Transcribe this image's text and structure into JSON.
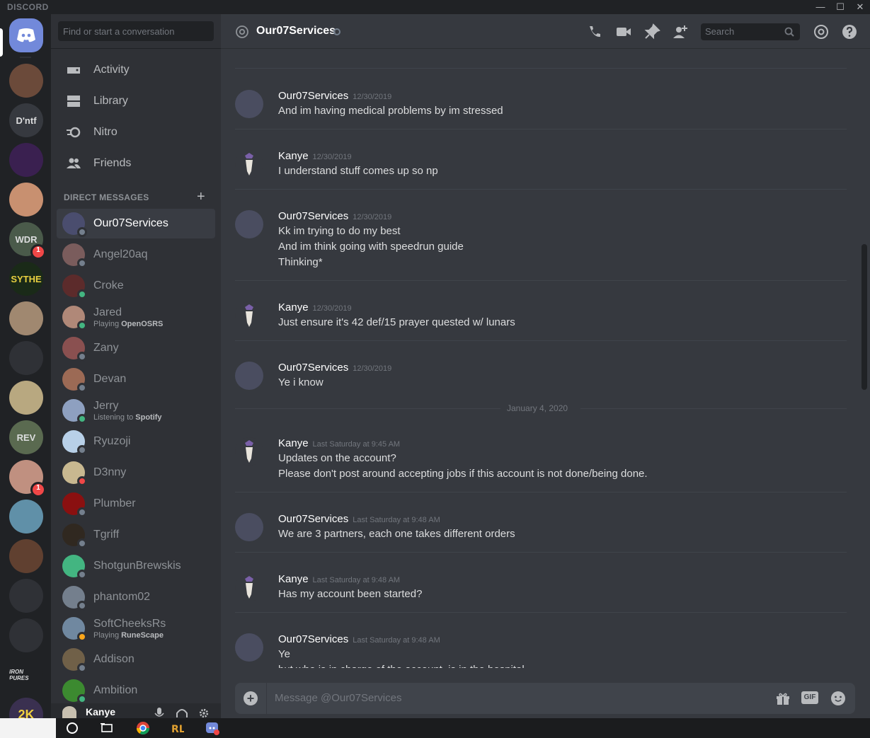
{
  "app": {
    "brand": "DISCORD"
  },
  "window_controls": {
    "minimize": "—",
    "maximize": "☐",
    "close": "✕"
  },
  "guilds": [
    {
      "name": "home",
      "text": ""
    },
    {
      "name": "server-1",
      "text": ""
    },
    {
      "name": "server-dntf",
      "text": "D'ntf"
    },
    {
      "name": "server-3",
      "text": ""
    },
    {
      "name": "server-4",
      "text": ""
    },
    {
      "name": "server-wdr",
      "text": "WDR",
      "badge": "1"
    },
    {
      "name": "server-sythe",
      "text": "SYTHE"
    },
    {
      "name": "server-8",
      "text": ""
    },
    {
      "name": "server-9",
      "text": ""
    },
    {
      "name": "server-10",
      "text": ""
    },
    {
      "name": "server-rev",
      "text": "REV"
    },
    {
      "name": "server-12",
      "text": "",
      "badge": "1"
    },
    {
      "name": "server-13",
      "text": ""
    },
    {
      "name": "server-14",
      "text": ""
    },
    {
      "name": "server-15",
      "text": ""
    },
    {
      "name": "server-16",
      "text": ""
    },
    {
      "name": "server-iron-pures",
      "text": "IRON PURES"
    },
    {
      "name": "server-2k",
      "text": "2K"
    }
  ],
  "sidebar": {
    "search_placeholder": "Find or start a conversation",
    "nav": [
      {
        "label": "Activity",
        "icon": "gamepad-icon"
      },
      {
        "label": "Library",
        "icon": "library-icon"
      },
      {
        "label": "Nitro",
        "icon": "nitro-icon"
      },
      {
        "label": "Friends",
        "icon": "friends-icon"
      }
    ],
    "dm_header": "DIRECT MESSAGES",
    "dm_add": "+",
    "dms": [
      {
        "name": "Our07Services",
        "status": "offline",
        "color": "#4a4d6e",
        "active": true
      },
      {
        "name": "Angel20aq",
        "status": "offline",
        "color": "#7a5c5c"
      },
      {
        "name": "Croke",
        "status": "online",
        "color": "#5c2b2b"
      },
      {
        "name": "Jared",
        "status": "online",
        "color": "#b08878",
        "activity_prefix": "Playing",
        "activity_name": "OpenOSRS"
      },
      {
        "name": "Zany",
        "status": "offline",
        "color": "#8a5050"
      },
      {
        "name": "Devan",
        "status": "offline",
        "color": "#9c6a55"
      },
      {
        "name": "Jerry",
        "status": "online",
        "color": "#8ea0c0",
        "activity_prefix": "Listening to",
        "activity_name": "Spotify"
      },
      {
        "name": "Ryuzoji",
        "status": "offline",
        "color": "#b8d0e8"
      },
      {
        "name": "D3nny",
        "status": "dnd",
        "color": "#c8b890"
      },
      {
        "name": "Plumber",
        "status": "offline",
        "color": "#8a1010"
      },
      {
        "name": "Tgriff",
        "status": "offline",
        "color": "#302820"
      },
      {
        "name": "ShotgunBrewskis",
        "status": "offline",
        "color": "#43b581"
      },
      {
        "name": "phantom02",
        "status": "offline",
        "color": "#747f8d"
      },
      {
        "name": "SoftCheeksRs",
        "status": "idle",
        "color": "#7088a0",
        "activity_prefix": "Playing",
        "activity_name": "RuneScape"
      },
      {
        "name": "Addison",
        "status": "offline",
        "color": "#706048"
      },
      {
        "name": "Ambition",
        "status": "online",
        "color": "#3c8a30"
      }
    ]
  },
  "user": {
    "name": "Kanye"
  },
  "chat": {
    "title": "Our07Services",
    "search_placeholder": "Search",
    "composer_placeholder": "Message @Our07Services",
    "gif_label": "GIF",
    "date_divider": "January 4, 2020",
    "messages": [
      {
        "author": "Our07Services",
        "time": "12/30/2019",
        "lines": [
          "And im having medical problems by im stressed"
        ]
      },
      {
        "author": "Kanye",
        "time": "12/30/2019",
        "lines": [
          "I understand stuff comes up so np"
        ]
      },
      {
        "author": "Our07Services",
        "time": "12/30/2019",
        "lines": [
          "Kk im trying to do my best",
          "And im think going with speedrun guide",
          "Thinking*"
        ]
      },
      {
        "author": "Kanye",
        "time": "12/30/2019",
        "lines": [
          "Just ensure it's 42 def/15 prayer quested w/ lunars"
        ]
      },
      {
        "author": "Our07Services",
        "time": "12/30/2019",
        "lines": [
          "Ye i know"
        ]
      },
      {
        "author": "Kanye",
        "time": "Last Saturday at 9:45 AM",
        "lines": [
          "Updates on the account?",
          "Please don't post around accepting jobs if this account is not done/being done."
        ]
      },
      {
        "author": "Our07Services",
        "time": "Last Saturday at 9:48 AM",
        "lines": [
          "We are 3 partners, each one takes different orders"
        ]
      },
      {
        "author": "Kanye",
        "time": "Last Saturday at 9:48 AM",
        "lines": [
          "Has my account been started?"
        ]
      },
      {
        "author": "Our07Services",
        "time": "Last Saturday at 9:48 AM",
        "lines": [
          "Ye",
          "but who is in charge of the account, is in the hospital"
        ]
      }
    ]
  },
  "colors": {
    "accent": "#7289da",
    "online": "#43b581",
    "dnd": "#f04747",
    "idle": "#faa61a",
    "offline": "#747f8d"
  }
}
